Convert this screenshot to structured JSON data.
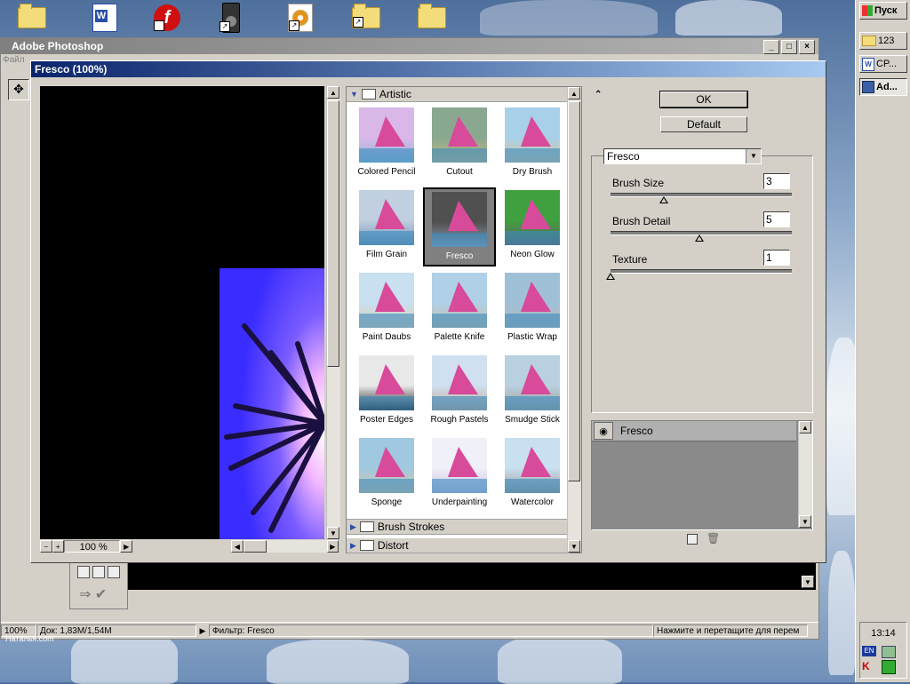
{
  "desktop": {
    "icons": [
      "folder-icon",
      "word-icon",
      "flash-icon",
      "speaker-icon",
      "cd-icon",
      "folder-icon",
      "folder-icon"
    ],
    "watermark": "Наталья.com"
  },
  "taskbar": {
    "start_label": "Пуск",
    "items": [
      {
        "label": "123"
      },
      {
        "label": "CP..."
      },
      {
        "label": "Ad..."
      }
    ],
    "clock": "13:14",
    "lang": "EN"
  },
  "photoshop": {
    "title": "Adobe Photoshop",
    "menu_first": "Файл",
    "status": {
      "zoom": "100%",
      "doc": "Док: 1,83M/1,54M",
      "filter": "Фильтр: Fresco",
      "hint": "Нажмите и перетащите для перем"
    }
  },
  "dialog": {
    "title": "Fresco (100%)",
    "zoom_label": "100 %",
    "gallery": {
      "category": "Artistic",
      "filters": [
        {
          "label": "Colored Pencil"
        },
        {
          "label": "Cutout"
        },
        {
          "label": "Dry Brush"
        },
        {
          "label": "Film Grain"
        },
        {
          "label": "Fresco"
        },
        {
          "label": "Neon Glow"
        },
        {
          "label": "Paint Daubs"
        },
        {
          "label": "Palette Knife"
        },
        {
          "label": "Plastic Wrap"
        },
        {
          "label": "Poster Edges"
        },
        {
          "label": "Rough Pastels"
        },
        {
          "label": "Smudge Stick"
        },
        {
          "label": "Sponge"
        },
        {
          "label": "Underpainting"
        },
        {
          "label": "Watercolor"
        }
      ],
      "selected": "Fresco",
      "other_categories": [
        "Brush Strokes",
        "Distort"
      ]
    },
    "controls": {
      "ok_label": "OK",
      "default_label": "Default",
      "filter_select": "Fresco",
      "params": [
        {
          "label": "Brush Size",
          "value": "3",
          "fraction": 0.3
        },
        {
          "label": "Brush Detail",
          "value": "5",
          "fraction": 0.5
        },
        {
          "label": "Texture",
          "value": "1",
          "fraction": 0.0
        }
      ],
      "layer_name": "Fresco"
    },
    "colors": {
      "title_bar": "#0a246a",
      "preview_bg": "#000000",
      "preview_art": "#3a2cff"
    }
  }
}
